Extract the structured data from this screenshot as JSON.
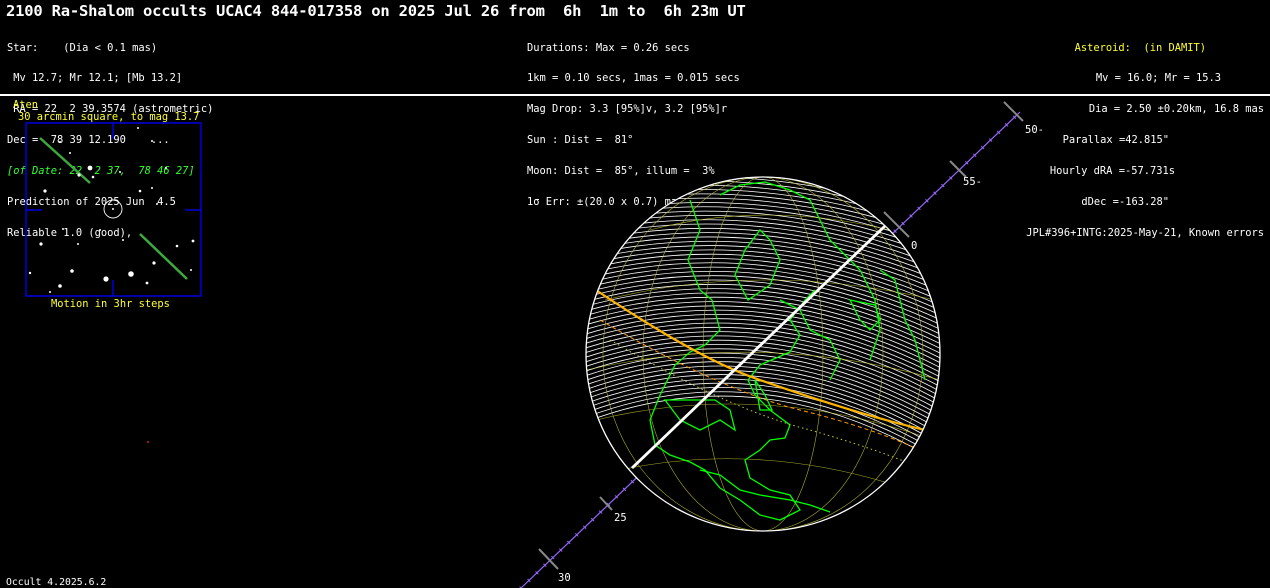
{
  "title": "2100 Ra-Shalom occults UCAC4 844-017358 on 2025 Jul 26 from  6h  1m to  6h 23m UT",
  "left_block": {
    "l1": "Star:    (Dia < 0.1 mas)",
    "l2": " Mv 12.7; Mr 12.1; [Mb 13.2]",
    "l3": " RA = 22  2 39.3574 (astrometric)",
    "l4": "Dec =  78 39 12.190    ...",
    "l5": "[of Date: 22  2 37,  78 46 27]",
    "l6": "Prediction of 2025 Jun  4.5",
    "l7": "Reliable 1.0 (good),"
  },
  "mid_block": {
    "l1": "Durations: Max = 0.26 secs",
    "l2": "1km = 0.10 secs, 1mas = 0.015 secs",
    "l3": "Mag Drop: 3.3 [95%]v, 3.2 [95%]r",
    "l4": "Sun : Dist =  81°",
    "l5": "Moon: Dist =  85°, illum =  3%",
    "l6": "1σ Err: ±(20.0 x 0.7) mas in PA 97°"
  },
  "right_block": {
    "l1": "Asteroid:  (in DAMIT)",
    "l2": "Mv = 16.0; Mr = 15.3",
    "l3": "Dia = 2.50 ±0.20km, 16.8 mas",
    "l4": "Parallax =42.815\"",
    "l5": "Hourly dRA =-57.731s",
    "l6": "dDec =-163.28\"",
    "l7": "JPL#396+INTG:2025-May-21, Known errors"
  },
  "finder": {
    "class_label": "Aten",
    "field_label": "30 arcmin square, to mag 13.7",
    "motion_label": "Motion in 3hr steps"
  },
  "track_labels": [
    "50-",
    "55-",
    "0",
    "25",
    "30"
  ],
  "footer": "Occult 4.2025.6.2",
  "colors": {
    "track": "#9966ff",
    "landmass": "#00ff00",
    "graticule": "#c8c832",
    "shadow_edge": "#ffb400",
    "box": "#0000ff",
    "label_yellow": "#ffff33"
  }
}
